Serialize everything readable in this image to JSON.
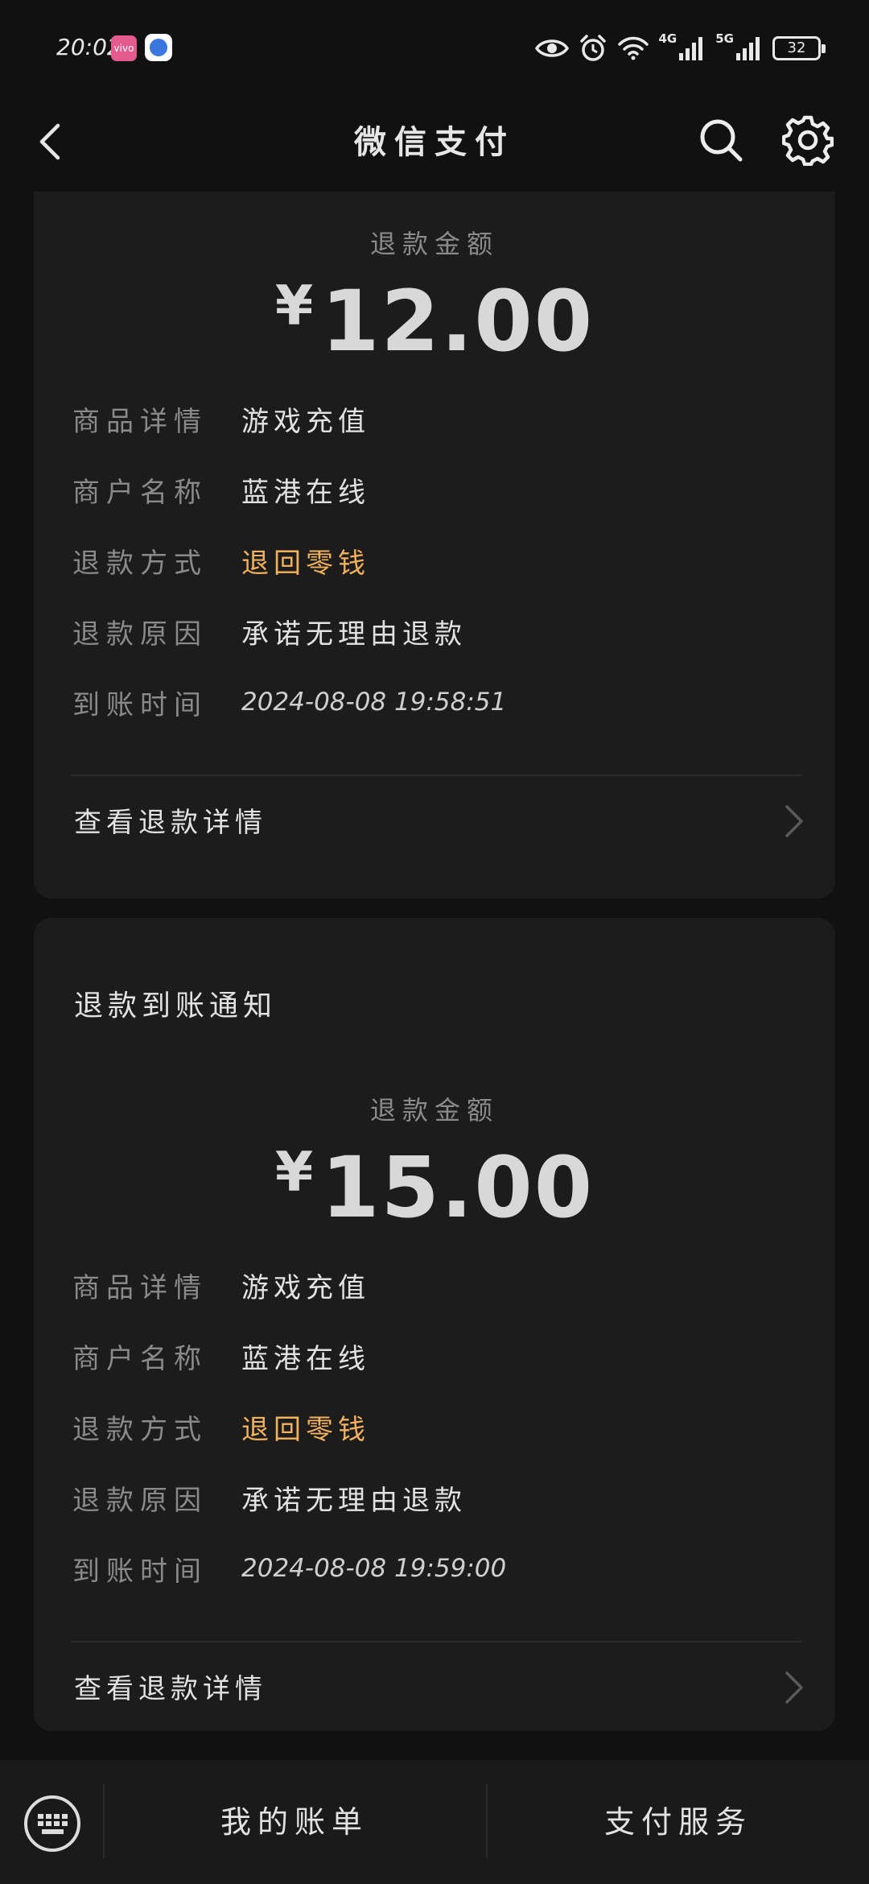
{
  "status_bar": {
    "time": "20:02",
    "app_icon_a_text": "vivo",
    "network_1": "4G",
    "network_2": "5G",
    "battery": "32"
  },
  "nav": {
    "title": "微信支付"
  },
  "cards": [
    {
      "amount_label": "退款金额",
      "currency": "¥",
      "amount": "12.00",
      "rows": [
        {
          "label": "商品详情",
          "value": "游戏充值"
        },
        {
          "label": "商户名称",
          "value": "蓝港在线"
        },
        {
          "label": "退款方式",
          "value": "退回零钱"
        },
        {
          "label": "退款原因",
          "value": "承诺无理由退款"
        },
        {
          "label": "到账时间",
          "value": "2024-08-08 19:58:51"
        }
      ],
      "detail_link": "查看退款详情"
    },
    {
      "title": "退款到账通知",
      "amount_label": "退款金额",
      "currency": "¥",
      "amount": "15.00",
      "rows": [
        {
          "label": "商品详情",
          "value": "游戏充值"
        },
        {
          "label": "商户名称",
          "value": "蓝港在线"
        },
        {
          "label": "退款方式",
          "value": "退回零钱"
        },
        {
          "label": "退款原因",
          "value": "承诺无理由退款"
        },
        {
          "label": "到账时间",
          "value": "2024-08-08 19:59:00"
        }
      ],
      "detail_link": "查看退款详情"
    }
  ],
  "bottom_bar": {
    "tab_bill": "我的账单",
    "tab_service": "支付服务"
  },
  "colors": {
    "background": "#111111",
    "card": "#1c1c1c",
    "accent": "#f2b15c"
  }
}
